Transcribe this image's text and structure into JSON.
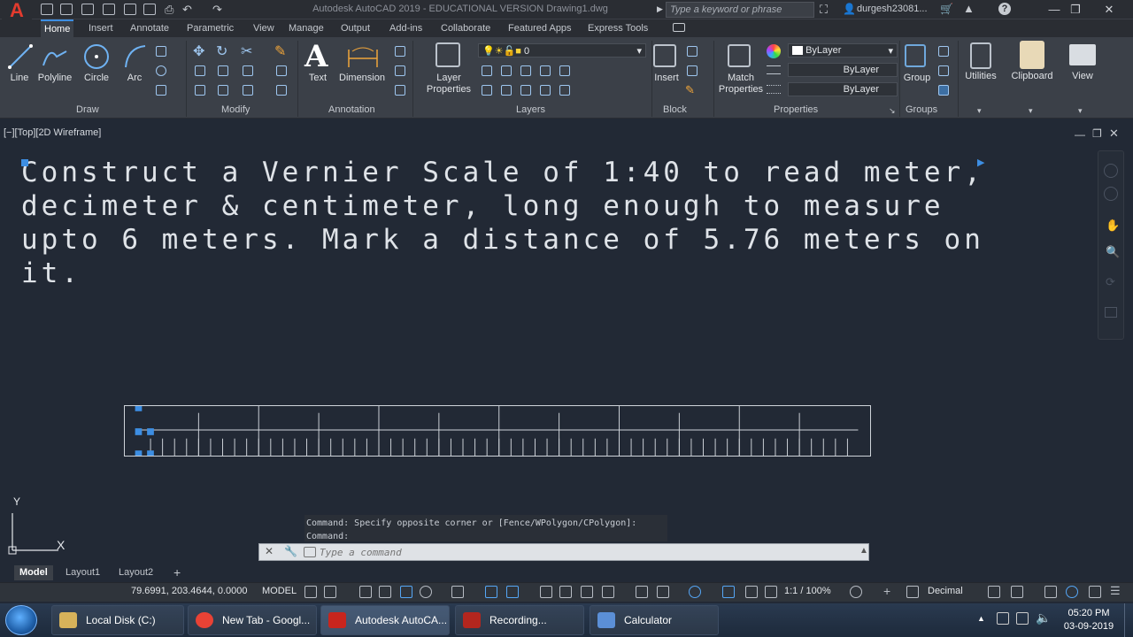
{
  "window": {
    "title": "Autodesk AutoCAD 2019 - EDUCATIONAL VERSION    Drawing1.dwg",
    "search_placeholder": "Type a keyword or phrase",
    "user": "durgesh23081..."
  },
  "tabs": [
    "Home",
    "Insert",
    "Annotate",
    "Parametric",
    "View",
    "Manage",
    "Output",
    "Add-ins",
    "Collaborate",
    "Featured Apps",
    "Express Tools"
  ],
  "ribbon": {
    "draw": {
      "line": "Line",
      "polyline": "Polyline",
      "circle": "Circle",
      "arc": "Arc",
      "panel": "Draw"
    },
    "modify": {
      "panel": "Modify"
    },
    "annotation": {
      "text": "Text",
      "dimension": "Dimension",
      "panel": "Annotation"
    },
    "layers": {
      "layer_properties": "Layer\nProperties",
      "layer_value": "0",
      "panel": "Layers"
    },
    "block": {
      "insert": "Insert",
      "panel": "Block"
    },
    "properties": {
      "match": "Match\nProperties",
      "color": "ByLayer",
      "linetype": "ByLayer",
      "lineweight": "ByLayer",
      "panel": "Properties"
    },
    "groups": {
      "group": "Group",
      "panel": "Groups"
    },
    "utilities": "Utilities",
    "clipboard": "Clipboard",
    "view": "View"
  },
  "viewport": {
    "label": "[−][Top][2D Wireframe]",
    "note": "Construct a Vernier Scale of 1:40 to read meter, decimeter & centimeter, long enough to measure upto 6 meters. Mark a distance of 5.76 meters on it."
  },
  "ucs": {
    "y": "Y",
    "x": "X"
  },
  "command": {
    "history": [
      "Command: Specify opposite corner or [Fence/WPolygon/CPolygon]:",
      "Command:"
    ],
    "placeholder": "Type a command"
  },
  "layout_tabs": [
    "Model",
    "Layout1",
    "Layout2"
  ],
  "status": {
    "coords": "79.6991, 203.4644, 0.0000",
    "space": "MODEL",
    "scale": "1:1 / 100%",
    "units": "Decimal"
  },
  "taskbar": {
    "items": [
      {
        "label": "Local Disk (C:)",
        "color": "#d7b25a"
      },
      {
        "label": "New Tab - Googl...",
        "color": "#e94235"
      },
      {
        "label": "Autodesk AutoCA...",
        "color": "#c8251d"
      },
      {
        "label": "Recording...",
        "color": "#b3261e"
      },
      {
        "label": "Calculator",
        "color": "#5b8fd6"
      }
    ],
    "time": "05:20 PM",
    "date": "03-09-2019"
  },
  "colors": {
    "accent": "#3d8ee3",
    "background": "#222935",
    "ribbon": "#3b4048"
  }
}
